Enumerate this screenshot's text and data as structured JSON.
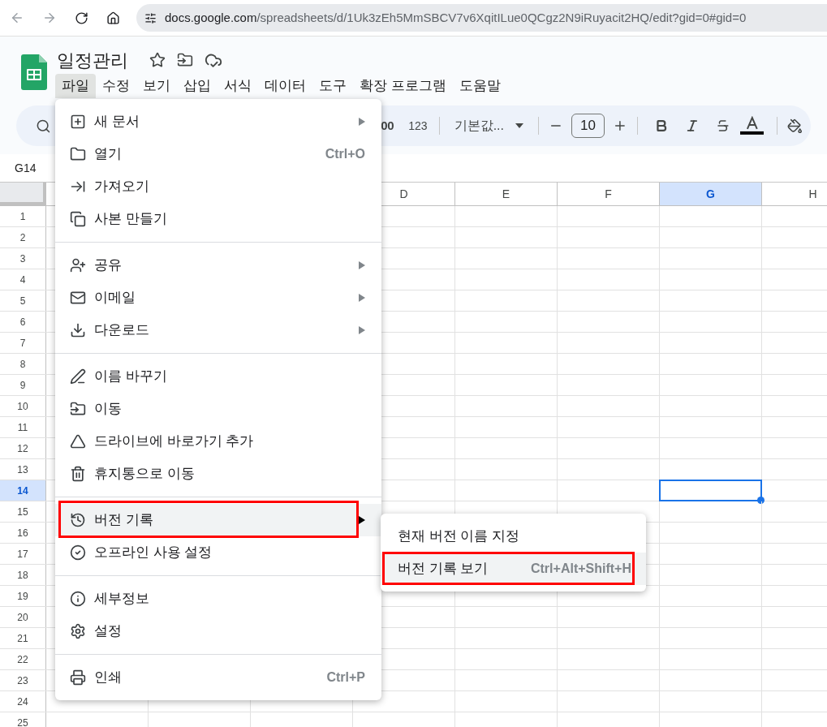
{
  "browser": {
    "url_host": "docs.google.com",
    "url_path": "/spreadsheets/d/1Uk3zEh5MmSBCV7v6XqitILue0QCgz2N9iRuyacit2HQ/edit?gid=0#gid=0"
  },
  "document": {
    "title": "일정관리"
  },
  "menu_bar": [
    {
      "label": "파일",
      "selected": true
    },
    {
      "label": "수정",
      "selected": false
    },
    {
      "label": "보기",
      "selected": false
    },
    {
      "label": "삽입",
      "selected": false
    },
    {
      "label": "서식",
      "selected": false
    },
    {
      "label": "데이터",
      "selected": false
    },
    {
      "label": "도구",
      "selected": false
    },
    {
      "label": "확장 프로그램",
      "selected": false
    },
    {
      "label": "도움말",
      "selected": false
    }
  ],
  "toolbar": {
    "decimal_label": "00",
    "number_format": "123",
    "font": "기본값...",
    "font_size": "10"
  },
  "name_box": "G14",
  "sheet": {
    "columns": [
      {
        "label": "D",
        "selected": false
      },
      {
        "label": "E",
        "selected": false
      },
      {
        "label": "F",
        "selected": false
      },
      {
        "label": "G",
        "selected": true
      },
      {
        "label": "H",
        "selected": false
      }
    ],
    "rows": [
      {
        "label": "1",
        "selected": false
      },
      {
        "label": "2",
        "selected": false
      },
      {
        "label": "3",
        "selected": false
      },
      {
        "label": "4",
        "selected": false
      },
      {
        "label": "5",
        "selected": false
      },
      {
        "label": "6",
        "selected": false
      },
      {
        "label": "7",
        "selected": false
      },
      {
        "label": "8",
        "selected": false
      },
      {
        "label": "9",
        "selected": false
      },
      {
        "label": "10",
        "selected": false
      },
      {
        "label": "11",
        "selected": false
      },
      {
        "label": "12",
        "selected": false
      },
      {
        "label": "13",
        "selected": false
      },
      {
        "label": "14",
        "selected": true
      },
      {
        "label": "15",
        "selected": false
      },
      {
        "label": "16",
        "selected": false
      },
      {
        "label": "17",
        "selected": false
      },
      {
        "label": "18",
        "selected": false
      },
      {
        "label": "19",
        "selected": false
      },
      {
        "label": "20",
        "selected": false
      },
      {
        "label": "21",
        "selected": false
      },
      {
        "label": "22",
        "selected": false
      },
      {
        "label": "23",
        "selected": false
      },
      {
        "label": "24",
        "selected": false
      },
      {
        "label": "25",
        "selected": false
      }
    ]
  },
  "file_menu": {
    "sections": [
      [
        {
          "kind": "new",
          "label": "새 문서",
          "submenu": true,
          "selected": false,
          "outlined": false
        },
        {
          "kind": "open",
          "label": "열기",
          "shortcut": "Ctrl+O",
          "submenu": false,
          "selected": false,
          "outlined": false
        },
        {
          "kind": "import",
          "label": "가져오기",
          "submenu": false,
          "selected": false,
          "outlined": false
        },
        {
          "kind": "copy",
          "label": "사본 만들기",
          "submenu": false,
          "selected": false,
          "outlined": false
        }
      ],
      [
        {
          "kind": "share",
          "label": "공유",
          "submenu": true,
          "selected": false,
          "outlined": false
        },
        {
          "kind": "email",
          "label": "이메일",
          "submenu": true,
          "selected": false,
          "outlined": false
        },
        {
          "kind": "download",
          "label": "다운로드",
          "submenu": true,
          "selected": false,
          "outlined": false
        }
      ],
      [
        {
          "kind": "rename",
          "label": "이름 바꾸기",
          "submenu": false,
          "selected": false,
          "outlined": false
        },
        {
          "kind": "move",
          "label": "이동",
          "submenu": false,
          "selected": false,
          "outlined": false
        },
        {
          "kind": "shortcut",
          "label": "드라이브에 바로가기 추가",
          "submenu": false,
          "selected": false,
          "outlined": false
        },
        {
          "kind": "trash",
          "label": "휴지통으로 이동",
          "submenu": false,
          "selected": false,
          "outlined": false
        }
      ],
      [
        {
          "kind": "history",
          "label": "버전 기록",
          "submenu": true,
          "selected": true,
          "outlined": true
        },
        {
          "kind": "offline",
          "label": "오프라인 사용 설정",
          "submenu": false,
          "selected": false,
          "outlined": false
        }
      ],
      [
        {
          "kind": "details",
          "label": "세부정보",
          "submenu": false,
          "selected": false,
          "outlined": false
        },
        {
          "kind": "settings",
          "label": "설정",
          "submenu": false,
          "selected": false,
          "outlined": false
        }
      ],
      [
        {
          "kind": "print",
          "label": "인쇄",
          "shortcut": "Ctrl+P",
          "submenu": false,
          "selected": false,
          "outlined": false
        }
      ]
    ]
  },
  "submenu": {
    "items": [
      {
        "label": "현재 버전 이름 지정",
        "selected": false,
        "outlined": false
      },
      {
        "label": "버전 기록 보기",
        "shortcut": "Ctrl+Alt+Shift+H",
        "selected": true,
        "outlined": true
      }
    ]
  }
}
